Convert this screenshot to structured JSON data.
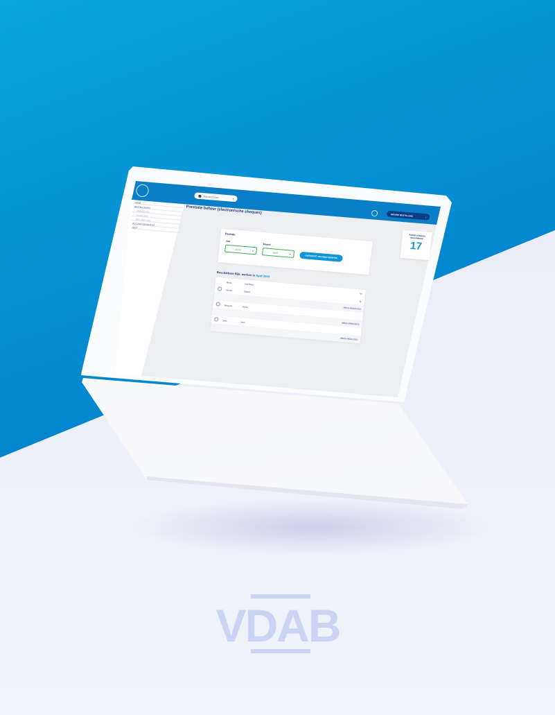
{
  "header": {
    "account_label": "MIJN ACCOUNT",
    "new_order_label": "NIEUWE BESTELLING",
    "new_order_arrow": "›",
    "chevron": "▾"
  },
  "nav": {
    "items": [
      {
        "label": "HOME",
        "chev": "›",
        "sub": false
      },
      {
        "label": "BESTELLINGEN",
        "chev": "›",
        "sub": false
      },
      {
        "label": "PRESTATIES",
        "chev": "›",
        "sub": true
      },
      {
        "label": "FINANCIEEL",
        "chev": "›",
        "sub": true
      },
      {
        "label": "DOCUMENTEN",
        "chev": "›",
        "sub": true
      },
      {
        "label": "ACCOUNTGEGEVENS",
        "chev": "›",
        "sub": false
      },
      {
        "label": "HELP",
        "chev": "›",
        "sub": false
      }
    ]
  },
  "main": {
    "page_title": "Prestatie beheer (electronische cheques)",
    "stat": {
      "label": "Aantal cheques beschikbaar",
      "value": "17"
    },
    "period": {
      "title": "Periode",
      "year_label": "Jaar",
      "year_value": "2019",
      "month_label": "Maand",
      "month_value": "April",
      "show_button": "OVERZICHT VAN MIJN WERKEN",
      "chevron": "▾"
    },
    "table": {
      "heading_prefix": "Beschikbare Bijk. werken in",
      "heading_highlight": "April 2019",
      "columns": [
        "Bruto",
        "Inschrijver",
        "Nr."
      ],
      "rows": [
        {
          "a": "Vincke",
          "b": "Gilbert",
          "c": "nr."
        },
        {
          "a": "",
          "b": "",
          "c": "ABCD-00001/2019"
        },
        {
          "a": "Vaneyck",
          "b": "Pierre",
          "c": ""
        },
        {
          "a": "",
          "b": "",
          "c": "ABCD-00001/2019"
        },
        {
          "a": "Jans",
          "b": "Jean",
          "c": ""
        },
        {
          "a": "",
          "b": "",
          "c": "ABCD-00001/2019"
        }
      ]
    }
  },
  "brand": {
    "logo_text": "VDAB",
    "logo_color": "#cdd3f3"
  },
  "colors": {
    "accent": "#0a7fc7",
    "dark_navy": "#093e86",
    "highlight": "#1197d6",
    "success": "#3cb048"
  }
}
